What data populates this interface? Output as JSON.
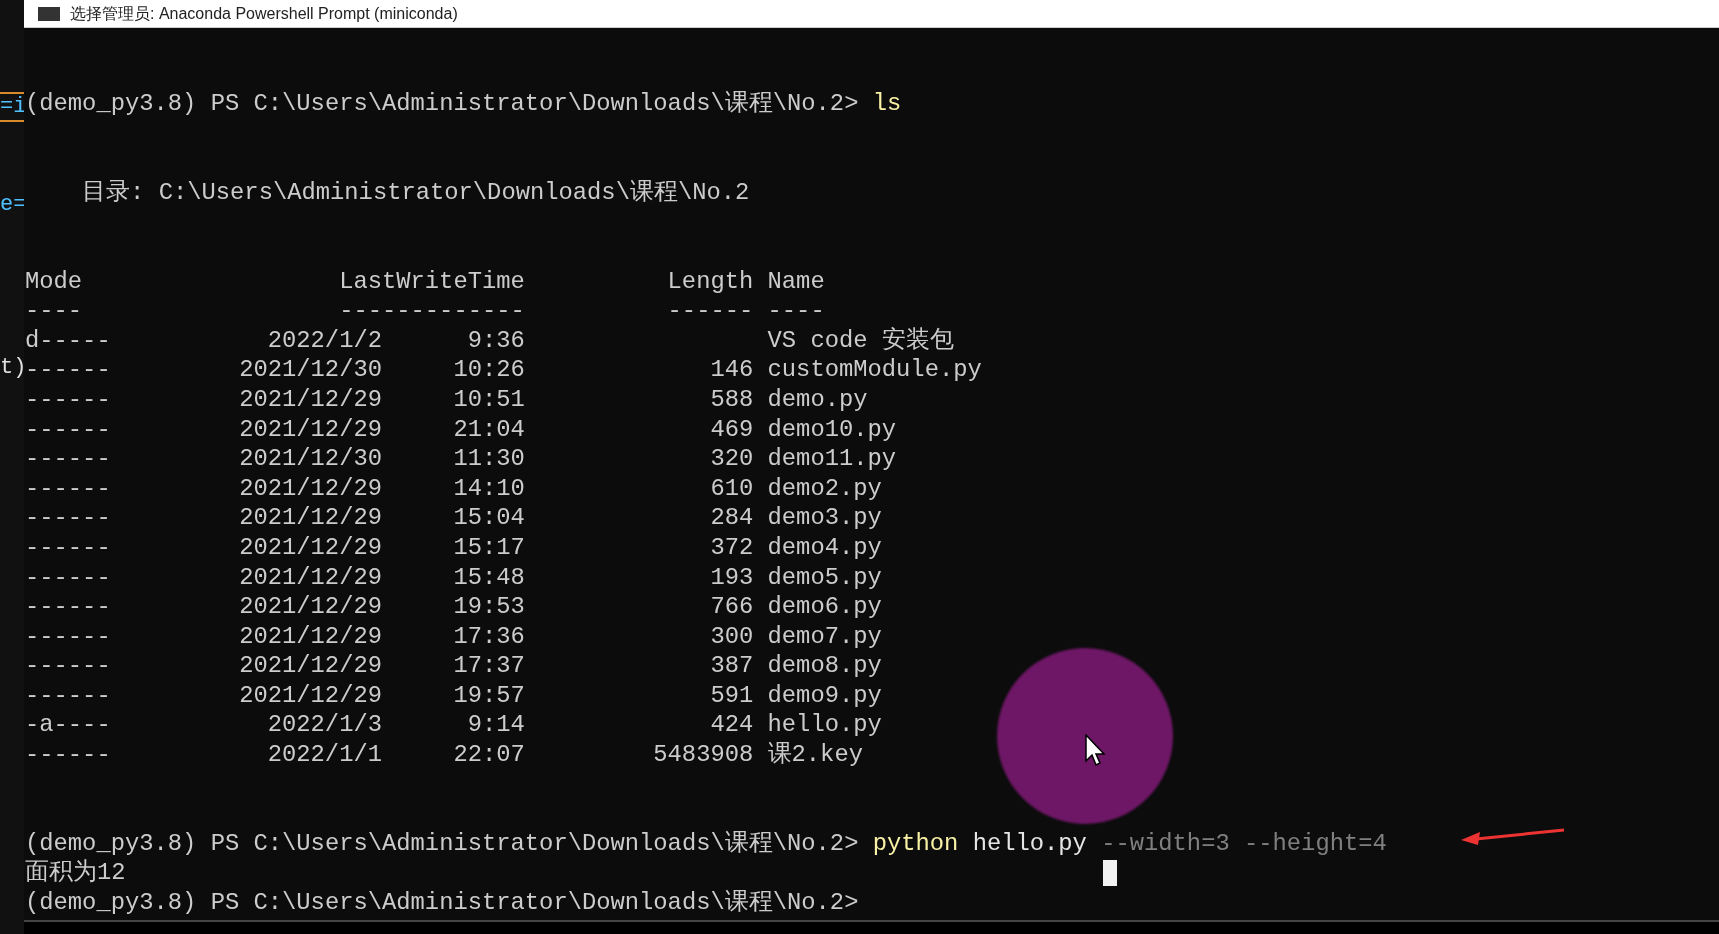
{
  "window": {
    "title": "选择管理员: Anaconda Powershell Prompt (miniconda)"
  },
  "background_editor": {
    "fragments": [
      {
        "text": "=i",
        "kind": "code"
      },
      {
        "text": "e=",
        "kind": "code"
      },
      {
        "text": "t)",
        "kind": "plain"
      }
    ]
  },
  "terminal": {
    "lines": [
      {
        "kind": "prompt",
        "prompt": "(demo_py3.8) PS C:\\Users\\Administrator\\Downloads\\课程\\No.2>",
        "command": [
          {
            "text": "ls",
            "kind": "command"
          }
        ]
      },
      {
        "kind": "blank"
      },
      {
        "kind": "blank"
      },
      {
        "kind": "directory",
        "text": "目录: C:\\Users\\Administrator\\Downloads\\课程\\No.2"
      },
      {
        "kind": "blank"
      },
      {
        "kind": "blank"
      },
      {
        "kind": "table",
        "columns": [
          {
            "label": "Mode",
            "rule": "----"
          },
          {
            "label": "LastWriteTime",
            "rule": "-------------"
          },
          {
            "label": "Length",
            "rule": "------"
          },
          {
            "label": "Name",
            "rule": "----"
          }
        ],
        "rows": [
          {
            "mode": "d-----",
            "date": "2022/1/2",
            "time": "9:36",
            "name": "VS code 安装包"
          },
          {
            "mode": "------",
            "date": "2021/12/30",
            "time": "10:26",
            "length": "146",
            "name": "customModule.py"
          },
          {
            "mode": "------",
            "date": "2021/12/29",
            "time": "10:51",
            "length": "588",
            "name": "demo.py"
          },
          {
            "mode": "------",
            "date": "2021/12/29",
            "time": "21:04",
            "length": "469",
            "name": "demo10.py"
          },
          {
            "mode": "------",
            "date": "2021/12/30",
            "time": "11:30",
            "length": "320",
            "name": "demo11.py"
          },
          {
            "mode": "------",
            "date": "2021/12/29",
            "time": "14:10",
            "length": "610",
            "name": "demo2.py"
          },
          {
            "mode": "------",
            "date": "2021/12/29",
            "time": "15:04",
            "length": "284",
            "name": "demo3.py"
          },
          {
            "mode": "------",
            "date": "2021/12/29",
            "time": "15:17",
            "length": "372",
            "name": "demo4.py"
          },
          {
            "mode": "------",
            "date": "2021/12/29",
            "time": "15:48",
            "length": "193",
            "name": "demo5.py"
          },
          {
            "mode": "------",
            "date": "2021/12/29",
            "time": "19:53",
            "length": "766",
            "name": "demo6.py"
          },
          {
            "mode": "------",
            "date": "2021/12/29",
            "time": "17:36",
            "length": "300",
            "name": "demo7.py"
          },
          {
            "mode": "------",
            "date": "2021/12/29",
            "time": "17:37",
            "length": "387",
            "name": "demo8.py"
          },
          {
            "mode": "------",
            "date": "2021/12/29",
            "time": "19:57",
            "length": "591",
            "name": "demo9.py"
          },
          {
            "mode": "-a----",
            "date": "2022/1/3",
            "time": "9:14",
            "length": "424",
            "name": "hello.py"
          },
          {
            "mode": "------",
            "date": "2022/1/1",
            "time": "22:07",
            "length": "5483908",
            "name": "课2.key"
          }
        ]
      },
      {
        "kind": "blank"
      },
      {
        "kind": "blank"
      },
      {
        "kind": "prompt",
        "prompt": "(demo_py3.8) PS C:\\Users\\Administrator\\Downloads\\课程\\No.2>",
        "command": [
          {
            "text": "python",
            "kind": "command"
          },
          {
            "text": "hello.py",
            "kind": "argument"
          },
          {
            "text": "--width=3 --height=4",
            "kind": "option"
          }
        ]
      },
      {
        "kind": "output",
        "text": "面积为12",
        "cursor": true
      },
      {
        "kind": "prompt",
        "prompt": "(demo_py3.8) PS C:\\Users\\Administrator\\Downloads\\课程\\No.2>"
      }
    ]
  }
}
